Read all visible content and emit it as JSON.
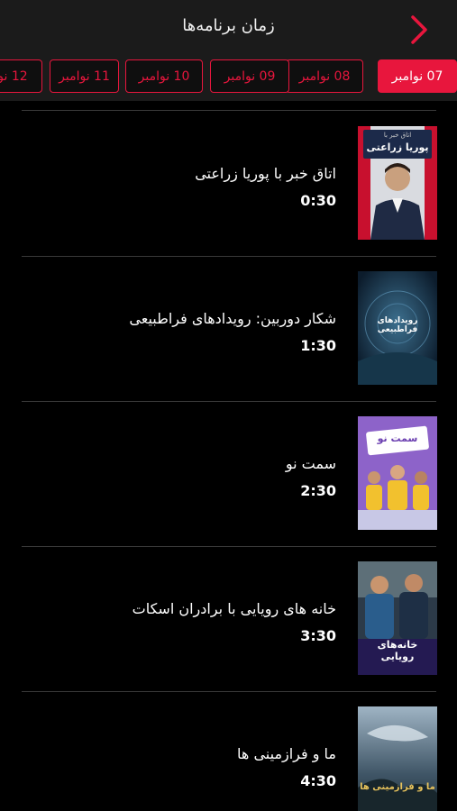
{
  "header": {
    "title": "زمان برنامه‌ها"
  },
  "tabs": [
    {
      "label": "07 نوامبر",
      "active": true
    },
    {
      "label": "08 نوامبر",
      "active": false
    },
    {
      "label": "09 نوامبر",
      "active": false
    },
    {
      "label": "10 نوامبر",
      "active": false
    },
    {
      "label": "11 نوامبر",
      "active": false
    },
    {
      "label": "12 نوا",
      "active": false
    }
  ],
  "programs": [
    {
      "name": "اتاق خبر با پوریا زراعتی",
      "time": "0:30",
      "thumb_text": "پوریا زراعتی",
      "thumb_sub": "اتاق خبر با"
    },
    {
      "name": "شکار دوربین: رویدادهای فراطبیعی",
      "time": "1:30",
      "thumb_text": "رویدادهای فراطبیعی"
    },
    {
      "name": "سمت نو",
      "time": "2:30",
      "thumb_text": "سمت نو"
    },
    {
      "name": "خانه های رویایی با برادران اسکات",
      "time": "3:30",
      "thumb_text": "خانه‌های رویایی"
    },
    {
      "name": "ما و فرازمینی ها",
      "time": "4:30",
      "thumb_text": "ما و فرازمینی ها"
    }
  ],
  "colors": {
    "accent": "#e8163d",
    "background": "#000000",
    "header_bg": "#1b1b1b"
  }
}
